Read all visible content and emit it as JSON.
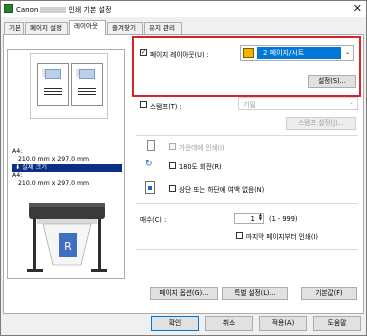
{
  "window": {
    "title_prefix": "Canon",
    "title_suffix": "인쇄 기본 설정",
    "close": "✕"
  },
  "tabs": [
    "기본",
    "페이지 설정",
    "레이아웃",
    "즐겨찾기",
    "유지 관리"
  ],
  "preview": {
    "page_numbers": [
      "1",
      "2"
    ],
    "size_label_1": "A4:",
    "size_value_1": "210.0 mm x 297.0 mm",
    "actual_size": "실제 크기",
    "size_label_2": "A4:",
    "size_value_2": "210.0 mm x 297.0 mm"
  },
  "layout": {
    "page_layout_label": "페이지 레이아웃(U) :",
    "page_layout_value": "2 페이지/시트",
    "settings_button": "설정(S)...",
    "stamp_label": "스탬프(T) :",
    "stamp_value": "기밀",
    "stamp_settings_button": "스탬프 설정(J)...",
    "print_background": "가운데에 인쇄(I)",
    "rotate_180": "180도 회전(R)",
    "no_margin": "상단 또는 하단에 여백 없음(N)",
    "copies_label": "매수(C) :",
    "copies_value": "1",
    "copies_range": "(1 - 999)",
    "reverse_order": "마지막 페이지부터 인쇄(I)"
  },
  "panel_buttons": {
    "page_options": "페이지 옵션(G)...",
    "special": "특별 설정(L)...",
    "defaults": "기본값(F)"
  },
  "dialog_buttons": {
    "ok": "확인",
    "cancel": "취소",
    "apply": "적용(A)",
    "help": "도움말"
  },
  "colors": {
    "highlight": "#d8232a",
    "selection": "#0a2f83",
    "accent": "#0078d7"
  }
}
